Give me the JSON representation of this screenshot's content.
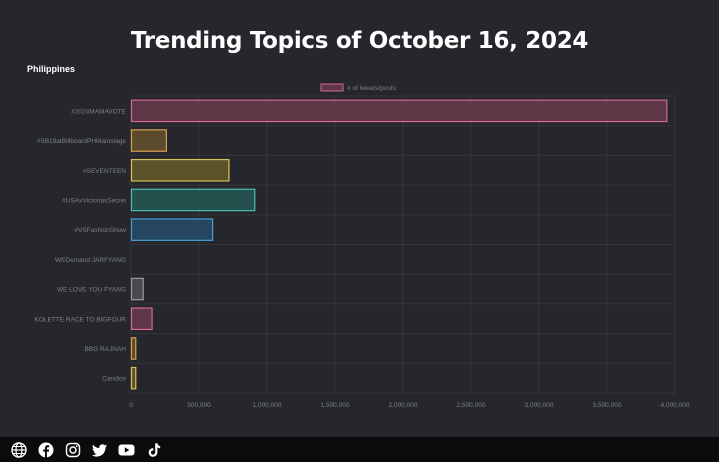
{
  "page": {
    "title": "Trending Topics of October 16, 2024",
    "region": "Philippines"
  },
  "chart_data": {
    "type": "bar",
    "orientation": "horizontal",
    "title": "Trending Topics of October 16, 2024",
    "categories": [
      "#2024MAMAVOTE",
      "#SB19atBillboardPHMainstage",
      "#SEVENTEEN",
      "#USAxVictoriasSecret",
      "#VSFashionShow",
      "WEDemand JARFYANG",
      "WE LOVE YOU FYANG",
      "KOLETTE RACE TO BIGFOUR",
      "BBG RAJNAH",
      "Candice"
    ],
    "series": [
      {
        "name": "# of tweets/posts",
        "values": [
          3940000,
          260000,
          720000,
          910000,
          600000,
          0,
          90000,
          155000,
          35000,
          35000
        ]
      }
    ],
    "bar_fills": [
      "#5e3847",
      "#5c4a2c",
      "#5a5229",
      "#24504e",
      "#25465e",
      "#4a4c52",
      "#484a4f",
      "#5e3847",
      "#5c4a2c",
      "#5a5229"
    ],
    "bar_strokes": [
      "#d46b8c",
      "#d9a050",
      "#d9c05a",
      "#4cbcb7",
      "#4a9ed4",
      "#8a8c92",
      "#9a9ca2",
      "#d46b8c",
      "#d9a050",
      "#d9c05a"
    ],
    "xlim": [
      0,
      4000000
    ],
    "xticks": [
      "0",
      "500,000",
      "1,000,000",
      "1,500,000",
      "2,000,000",
      "2,500,000",
      "3,000,000",
      "3,500,000",
      "4,000,000"
    ],
    "grid": true,
    "legend_position": "top-center"
  },
  "colors": {
    "background": "#25272c",
    "gridline": "#34363b",
    "label_text": "#7d8087",
    "legend_swatch_fill": "#5e3847",
    "legend_swatch_stroke": "#d46b8c"
  },
  "footer": {
    "icons": [
      "globe-icon",
      "facebook-icon",
      "instagram-icon",
      "twitter-icon",
      "youtube-icon",
      "tiktok-icon"
    ]
  }
}
